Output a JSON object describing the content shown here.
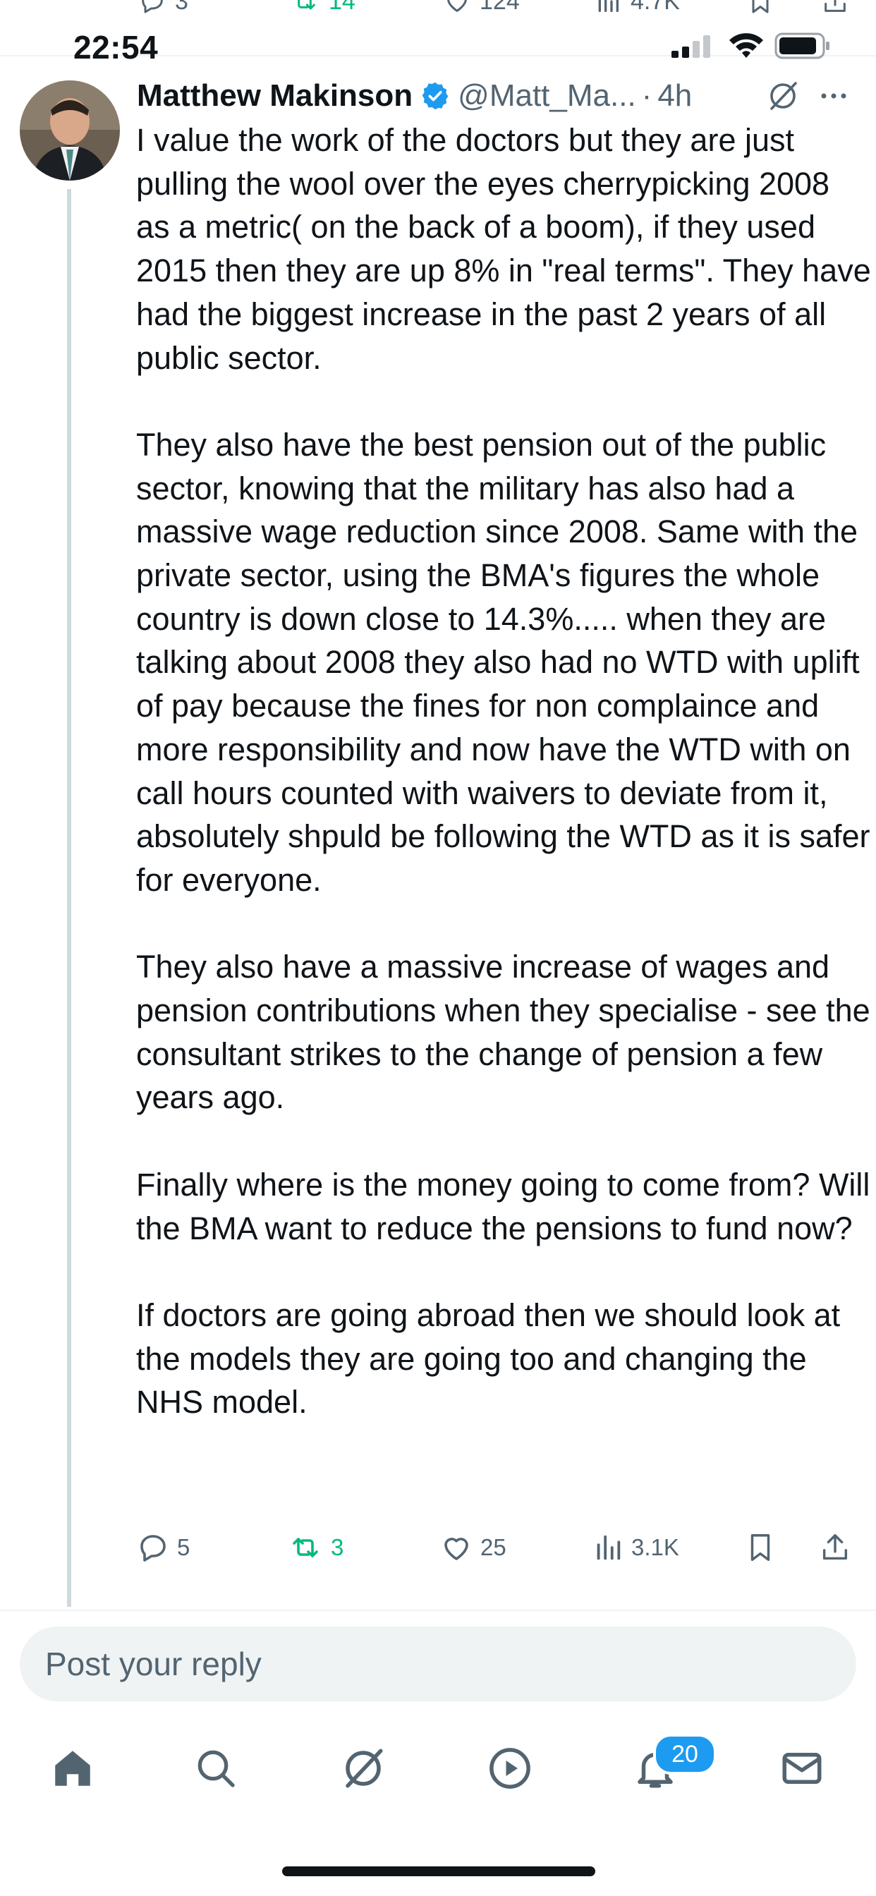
{
  "prev_tweet_actions": {
    "replies": "3",
    "reposts": "14",
    "likes": "124",
    "views": "4.7K"
  },
  "status_bar": {
    "time": "22:54"
  },
  "tweet": {
    "author_name": "Matthew Makinson",
    "handle": "@Matt_Ma...",
    "separator": "·",
    "time_ago": "4h",
    "body": "I value the work of the doctors but they are just pulling the wool over the eyes cherrypicking 2008 as a metric( on the back of a boom), if they used 2015 then they are up 8% in \"real terms\". They have had the biggest increase in the past 2 years of all public sector.\n\nThey also have the best pension out of the public sector, knowing that the military has also had a massive wage reduction since 2008. Same with the private sector, using the BMA's figures the whole country is down close to 14.3%..... when they are talking about 2008 they also had no WTD with uplift of pay because the fines for non complaince and more responsibility and now have the WTD with on call hours counted with waivers to deviate from it, absolutely shpuld be following the WTD as it is safer for everyone.\n\nThey also have a massive increase of wages and pension contributions when they specialise - see the consultant strikes to the change of pension a few years ago.\n\nFinally where is the money going to come from? Will the BMA want to reduce the pensions to fund now?\n\nIf doctors are going abroad then we should look at the models they are going too and changing the NHS model.",
    "replies": "5",
    "reposts": "3",
    "likes": "25",
    "views": "3.1K"
  },
  "reply_box": {
    "placeholder": "Post your reply"
  },
  "bottom_nav": {
    "notifications_badge": "20"
  },
  "colors": {
    "accent": "#1d9bf0",
    "repost_green": "#00ba7c",
    "secondary_text": "#536471",
    "thread_line": "#cfd9de"
  }
}
